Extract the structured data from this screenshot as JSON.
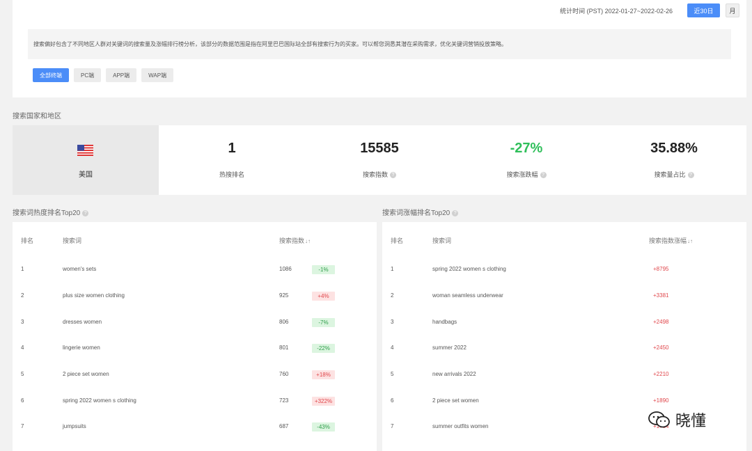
{
  "header": {
    "stat_time": "统计时间 (PST) 2022-01-27~2022-02-26",
    "btn_30days": "近30日",
    "btn_month": "月",
    "description": "搜索偏好包含了不同地区人群对关键词的搜索量及涨幅排行榜分析，该部分的数据范围是指在阿里巴巴国际站全部有搜索行为的买家。可以帮您洞悉其潜在采购需求，优化关键词营销投放策略。",
    "terminal_tabs": [
      "全部终端",
      "PC端",
      "APP端",
      "WAP端"
    ]
  },
  "country_section": {
    "label": "搜索国家和地区",
    "country": "美国",
    "metrics": [
      {
        "value": "1",
        "label": "热搜排名",
        "has_help": false
      },
      {
        "value": "15585",
        "label": "搜索指数",
        "has_help": true
      },
      {
        "value": "-27%",
        "label": "搜索涨跌幅",
        "has_help": true
      },
      {
        "value": "35.88%",
        "label": "搜索量占比",
        "has_help": true
      }
    ]
  },
  "hot_table": {
    "title": "搜索词热度排名Top20",
    "col_rank": "排名",
    "col_keyword": "搜索词",
    "col_index": "搜索指数",
    "rows": [
      {
        "rank": "1",
        "keyword": "women's sets",
        "index": "1086",
        "change": "-1%",
        "dir": "down"
      },
      {
        "rank": "2",
        "keyword": "plus size women clothing",
        "index": "925",
        "change": "+4%",
        "dir": "up"
      },
      {
        "rank": "3",
        "keyword": "dresses women",
        "index": "806",
        "change": "-7%",
        "dir": "down"
      },
      {
        "rank": "4",
        "keyword": "lingerie women",
        "index": "801",
        "change": "-22%",
        "dir": "down"
      },
      {
        "rank": "5",
        "keyword": "2 piece set women",
        "index": "760",
        "change": "+18%",
        "dir": "up"
      },
      {
        "rank": "6",
        "keyword": "spring 2022 women s clothing",
        "index": "723",
        "change": "+322%",
        "dir": "up"
      },
      {
        "rank": "7",
        "keyword": "jumpsuits",
        "index": "687",
        "change": "-43%",
        "dir": "down"
      }
    ]
  },
  "growth_table": {
    "title": "搜索词涨幅排名Top20",
    "col_rank": "排名",
    "col_keyword": "搜索词",
    "col_growth": "搜索指数涨幅",
    "rows": [
      {
        "rank": "1",
        "keyword": "spring 2022 women s clothing",
        "growth": "+8795"
      },
      {
        "rank": "2",
        "keyword": "woman seamless underwear",
        "growth": "+3381"
      },
      {
        "rank": "3",
        "keyword": "handbags",
        "growth": "+2498"
      },
      {
        "rank": "4",
        "keyword": "summer 2022",
        "growth": "+2450"
      },
      {
        "rank": "5",
        "keyword": "new arrivals 2022",
        "growth": "+2210"
      },
      {
        "rank": "6",
        "keyword": "2 piece set women",
        "growth": "+1890"
      },
      {
        "rank": "7",
        "keyword": "summer outfits women",
        "growth": "+1734"
      }
    ]
  },
  "watermark": {
    "text": "晓懂"
  },
  "colors": {
    "primary": "#4b8df8",
    "green": "#2fbf5a",
    "red": "#e0474c"
  }
}
